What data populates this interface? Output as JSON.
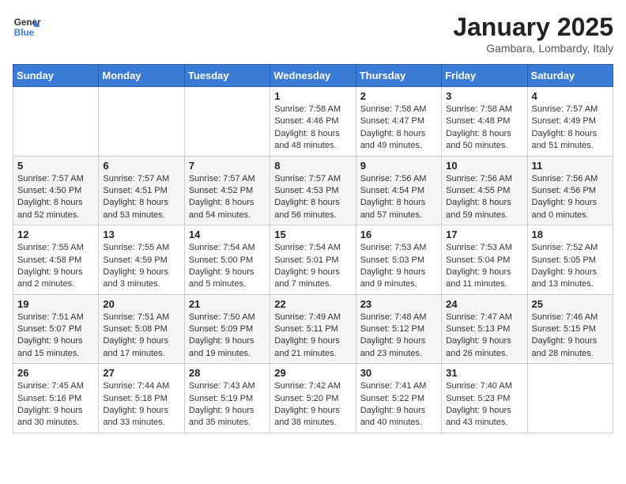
{
  "header": {
    "logo_general": "General",
    "logo_blue": "Blue",
    "month_title": "January 2025",
    "location": "Gambara, Lombardy, Italy"
  },
  "weekdays": [
    "Sunday",
    "Monday",
    "Tuesday",
    "Wednesday",
    "Thursday",
    "Friday",
    "Saturday"
  ],
  "weeks": [
    [
      {
        "day": "",
        "sunrise": "",
        "sunset": "",
        "daylight": ""
      },
      {
        "day": "",
        "sunrise": "",
        "sunset": "",
        "daylight": ""
      },
      {
        "day": "",
        "sunrise": "",
        "sunset": "",
        "daylight": ""
      },
      {
        "day": "1",
        "sunrise": "7:58 AM",
        "sunset": "4:46 PM",
        "daylight": "8 hours and 48 minutes."
      },
      {
        "day": "2",
        "sunrise": "7:58 AM",
        "sunset": "4:47 PM",
        "daylight": "8 hours and 49 minutes."
      },
      {
        "day": "3",
        "sunrise": "7:58 AM",
        "sunset": "4:48 PM",
        "daylight": "8 hours and 50 minutes."
      },
      {
        "day": "4",
        "sunrise": "7:57 AM",
        "sunset": "4:49 PM",
        "daylight": "8 hours and 51 minutes."
      }
    ],
    [
      {
        "day": "5",
        "sunrise": "7:57 AM",
        "sunset": "4:50 PM",
        "daylight": "8 hours and 52 minutes."
      },
      {
        "day": "6",
        "sunrise": "7:57 AM",
        "sunset": "4:51 PM",
        "daylight": "8 hours and 53 minutes."
      },
      {
        "day": "7",
        "sunrise": "7:57 AM",
        "sunset": "4:52 PM",
        "daylight": "8 hours and 54 minutes."
      },
      {
        "day": "8",
        "sunrise": "7:57 AM",
        "sunset": "4:53 PM",
        "daylight": "8 hours and 56 minutes."
      },
      {
        "day": "9",
        "sunrise": "7:56 AM",
        "sunset": "4:54 PM",
        "daylight": "8 hours and 57 minutes."
      },
      {
        "day": "10",
        "sunrise": "7:56 AM",
        "sunset": "4:55 PM",
        "daylight": "8 hours and 59 minutes."
      },
      {
        "day": "11",
        "sunrise": "7:56 AM",
        "sunset": "4:56 PM",
        "daylight": "9 hours and 0 minutes."
      }
    ],
    [
      {
        "day": "12",
        "sunrise": "7:55 AM",
        "sunset": "4:58 PM",
        "daylight": "9 hours and 2 minutes."
      },
      {
        "day": "13",
        "sunrise": "7:55 AM",
        "sunset": "4:59 PM",
        "daylight": "9 hours and 3 minutes."
      },
      {
        "day": "14",
        "sunrise": "7:54 AM",
        "sunset": "5:00 PM",
        "daylight": "9 hours and 5 minutes."
      },
      {
        "day": "15",
        "sunrise": "7:54 AM",
        "sunset": "5:01 PM",
        "daylight": "9 hours and 7 minutes."
      },
      {
        "day": "16",
        "sunrise": "7:53 AM",
        "sunset": "5:03 PM",
        "daylight": "9 hours and 9 minutes."
      },
      {
        "day": "17",
        "sunrise": "7:53 AM",
        "sunset": "5:04 PM",
        "daylight": "9 hours and 11 minutes."
      },
      {
        "day": "18",
        "sunrise": "7:52 AM",
        "sunset": "5:05 PM",
        "daylight": "9 hours and 13 minutes."
      }
    ],
    [
      {
        "day": "19",
        "sunrise": "7:51 AM",
        "sunset": "5:07 PM",
        "daylight": "9 hours and 15 minutes."
      },
      {
        "day": "20",
        "sunrise": "7:51 AM",
        "sunset": "5:08 PM",
        "daylight": "9 hours and 17 minutes."
      },
      {
        "day": "21",
        "sunrise": "7:50 AM",
        "sunset": "5:09 PM",
        "daylight": "9 hours and 19 minutes."
      },
      {
        "day": "22",
        "sunrise": "7:49 AM",
        "sunset": "5:11 PM",
        "daylight": "9 hours and 21 minutes."
      },
      {
        "day": "23",
        "sunrise": "7:48 AM",
        "sunset": "5:12 PM",
        "daylight": "9 hours and 23 minutes."
      },
      {
        "day": "24",
        "sunrise": "7:47 AM",
        "sunset": "5:13 PM",
        "daylight": "9 hours and 26 minutes."
      },
      {
        "day": "25",
        "sunrise": "7:46 AM",
        "sunset": "5:15 PM",
        "daylight": "9 hours and 28 minutes."
      }
    ],
    [
      {
        "day": "26",
        "sunrise": "7:45 AM",
        "sunset": "5:16 PM",
        "daylight": "9 hours and 30 minutes."
      },
      {
        "day": "27",
        "sunrise": "7:44 AM",
        "sunset": "5:18 PM",
        "daylight": "9 hours and 33 minutes."
      },
      {
        "day": "28",
        "sunrise": "7:43 AM",
        "sunset": "5:19 PM",
        "daylight": "9 hours and 35 minutes."
      },
      {
        "day": "29",
        "sunrise": "7:42 AM",
        "sunset": "5:20 PM",
        "daylight": "9 hours and 38 minutes."
      },
      {
        "day": "30",
        "sunrise": "7:41 AM",
        "sunset": "5:22 PM",
        "daylight": "9 hours and 40 minutes."
      },
      {
        "day": "31",
        "sunrise": "7:40 AM",
        "sunset": "5:23 PM",
        "daylight": "9 hours and 43 minutes."
      },
      {
        "day": "",
        "sunrise": "",
        "sunset": "",
        "daylight": ""
      }
    ]
  ]
}
